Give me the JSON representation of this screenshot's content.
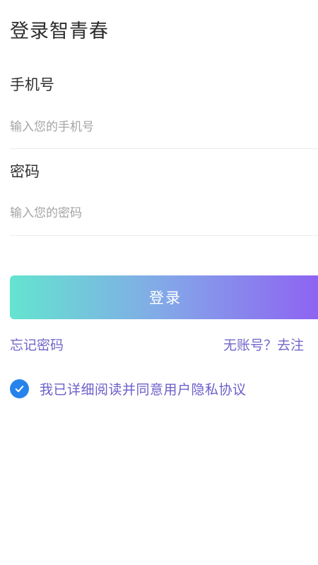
{
  "header": {
    "title": "登录智青春"
  },
  "form": {
    "phone": {
      "label": "手机号",
      "placeholder": "输入您的手机号",
      "value": ""
    },
    "password": {
      "label": "密码",
      "placeholder": "输入您的密码",
      "value": ""
    },
    "login_label": "登录"
  },
  "links": {
    "forgot": "忘记密码",
    "register": "无账号？去注"
  },
  "agreement": {
    "checked": true,
    "text": "我已详细阅读并同意用户隐私协议"
  },
  "colors": {
    "accent": "#7266c9",
    "check": "#2783ec",
    "gradient_start": "#64e4cf",
    "gradient_end": "#8e62f2"
  },
  "icons": {
    "agree": "check-circle-icon"
  }
}
